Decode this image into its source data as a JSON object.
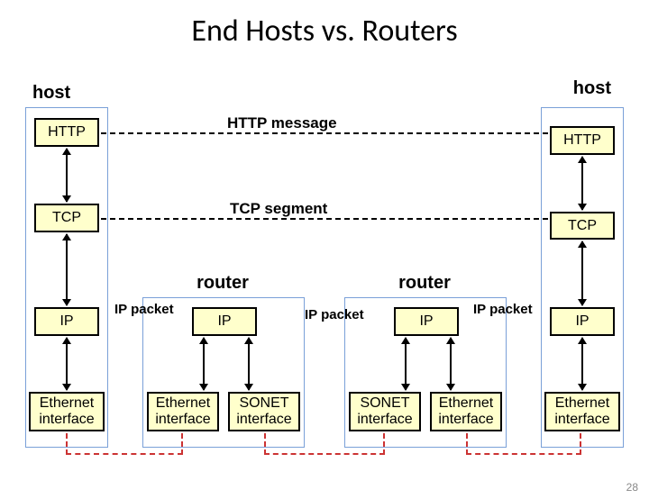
{
  "title": "End Hosts vs. Routers",
  "labels": {
    "host_left": "host",
    "host_right": "host",
    "router_left": "router",
    "router_right": "router"
  },
  "messages": {
    "http": "HTTP message",
    "tcp": "TCP segment",
    "ip1": "IP packet",
    "ip2": "IP packet",
    "ip3": "IP packet"
  },
  "host_stack": {
    "http": "HTTP",
    "tcp": "TCP",
    "ip": "IP",
    "eth": "Ethernet interface"
  },
  "router_stack": {
    "ip": "IP",
    "eth": "Ethernet interface",
    "sonet": "SONET interface"
  },
  "page_number": "28"
}
